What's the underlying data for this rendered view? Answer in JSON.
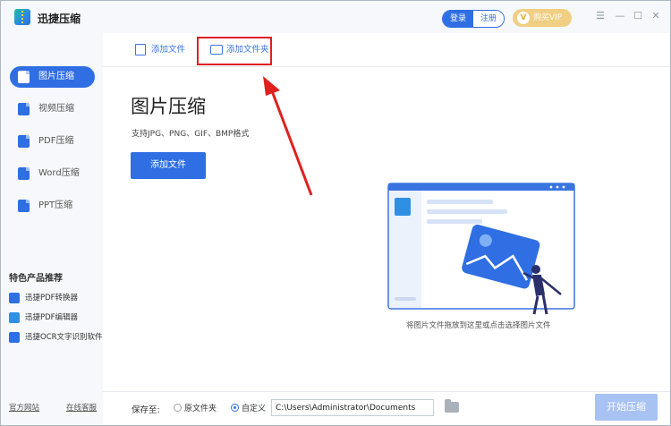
{
  "app": {
    "title": "迅捷压缩"
  },
  "header": {
    "login_label": "登录",
    "register_label": "注册",
    "vip_label": "购买VIP",
    "vip_badge": "V",
    "menu_icon": "menu-icon",
    "min_icon": "minimize-icon",
    "max_icon": "maximize-icon",
    "close_icon": "close-icon",
    "menu_glyph": "☰",
    "min_glyph": "—",
    "max_glyph": "☐",
    "close_glyph": "✕"
  },
  "sidebar": {
    "items": [
      {
        "label": "图片压缩",
        "icon": "image-file-icon",
        "active": true
      },
      {
        "label": "视频压缩",
        "icon": "video-file-icon",
        "active": false
      },
      {
        "label": "PDF压缩",
        "icon": "pdf-file-icon",
        "active": false
      },
      {
        "label": "Word压缩",
        "icon": "word-file-icon",
        "active": false
      },
      {
        "label": "PPT压缩",
        "icon": "ppt-file-icon",
        "active": false
      }
    ],
    "featured_title": "特色产品推荐",
    "products": [
      {
        "label": "迅捷PDF转换器",
        "icon": "pdf-converter-icon",
        "color": "#2f6ee3"
      },
      {
        "label": "迅捷PDF编辑器",
        "icon": "pdf-editor-icon",
        "color": "#2f8fe3"
      },
      {
        "label": "迅捷OCR文字识别软件",
        "icon": "ocr-icon",
        "color": "#2f6ee3"
      }
    ],
    "footer_links": [
      "官方网站",
      "在线客服"
    ]
  },
  "toolbar": {
    "add_file_label": "添加文件",
    "add_folder_label": "添加文件夹"
  },
  "main": {
    "title": "图片压缩",
    "subtitle": "支持JPG、PNG、GIF、BMP格式",
    "add_button_label": "添加文件",
    "drop_hint": "将图片文件拖放到这里或点击选择图片文件"
  },
  "bottom": {
    "save_label": "保存至:",
    "option_original": "原文件夹",
    "option_custom": "自定义",
    "selected_option": "自定义",
    "path_value": "C:\\Users\\Administrator\\Documents",
    "start_label": "开始压缩"
  },
  "colors": {
    "accent": "#2f6ee3",
    "vip": "#f0ce82",
    "annotation": "#e02020"
  }
}
